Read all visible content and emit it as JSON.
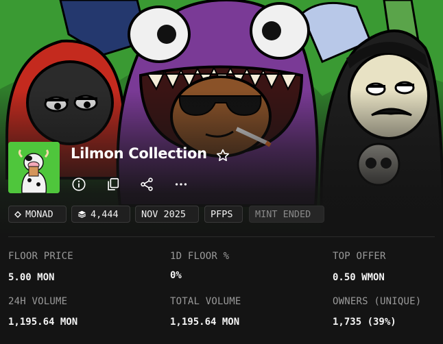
{
  "collection": {
    "name": "Lilmon Collection",
    "avatar_icon": "cow-avatar-icon",
    "favorite_icon": "star-outline-icon"
  },
  "actions": [
    {
      "name": "info",
      "icon": "info-icon"
    },
    {
      "name": "copy",
      "icon": "copy-icon"
    },
    {
      "name": "share",
      "icon": "share-icon"
    },
    {
      "name": "more",
      "icon": "more-horizontal-icon"
    }
  ],
  "tags": {
    "chain": "MONAD",
    "chain_icon": "diamond-icon",
    "supply": "4,444",
    "supply_icon": "layers-icon",
    "date": "NOV 2025",
    "category": "PFPS",
    "status": "MINT ENDED"
  },
  "stats": {
    "floor_price_label": "FLOOR PRICE",
    "floor_price_value": "5.00 MON",
    "floor_change_label": "1D FLOOR %",
    "floor_change_value": "0%",
    "top_offer_label": "TOP OFFER",
    "top_offer_value": "0.50 WMON",
    "volume_24h_label": "24H VOLUME",
    "volume_24h_value": "1,195.64 MON",
    "total_volume_label": "TOTAL VOLUME",
    "total_volume_value": "1,195.64 MON",
    "owners_label": "OWNERS (UNIQUE)",
    "owners_value": "1,735 (39%)"
  },
  "colors": {
    "background": "#141414",
    "tag_border": "#3a3a3a",
    "label_gray": "#9a9a9a",
    "monster_purple": "#7a3a96",
    "banner_green": "#2e8a2c"
  }
}
